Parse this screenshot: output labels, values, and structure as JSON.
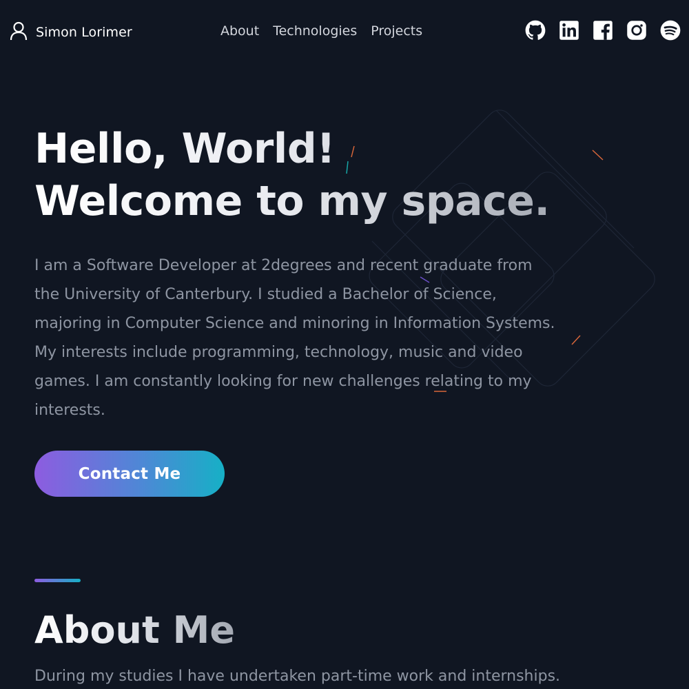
{
  "nav": {
    "brand_name": "Simon Lorimer",
    "links": [
      "About",
      "Technologies",
      "Projects"
    ],
    "socials": [
      "github-icon",
      "linkedin-icon",
      "facebook-icon",
      "instagram-icon",
      "spotify-icon"
    ]
  },
  "hero": {
    "title_line1": "Hello, World!",
    "title_line2": "Welcome to my space.",
    "bio": "I am a Software Developer at 2degrees and recent graduate from the University of Canterbury. I studied a Bachelor of Science, majoring in Computer Science and minoring in Information Systems. My interests include programming, technology, music and video games. I am constantly looking for new challenges relating to my interests.",
    "contact_label": "Contact Me"
  },
  "about": {
    "title": "About Me",
    "text": "During my studies I have undertaken part-time work and internships."
  },
  "colors": {
    "background": "#101622",
    "accent_start": "#8d5ce0",
    "accent_end": "#16b0c6"
  }
}
